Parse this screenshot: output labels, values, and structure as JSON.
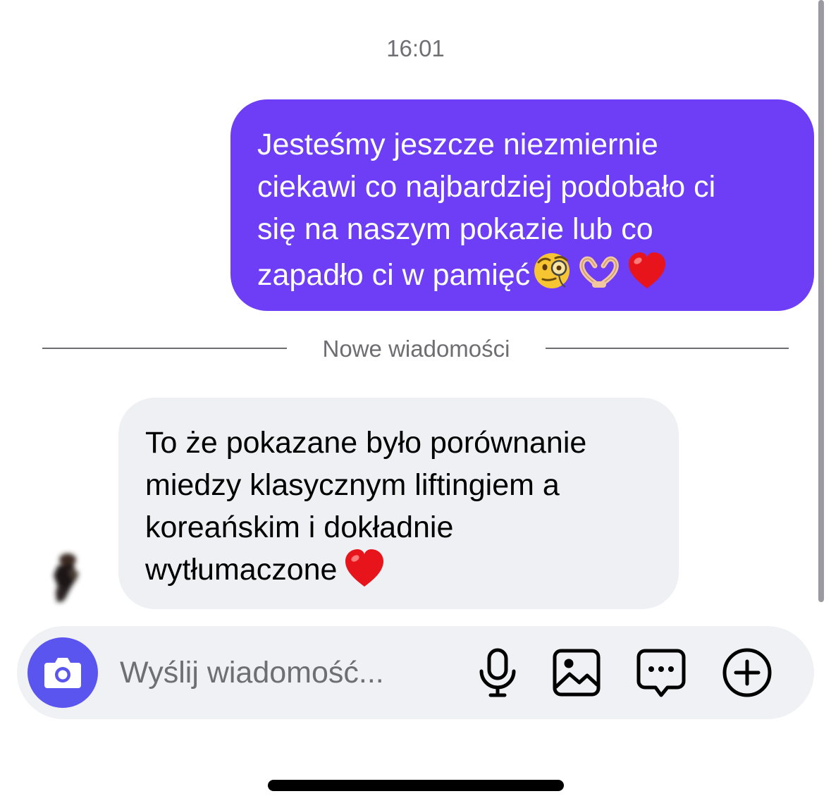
{
  "conversation": {
    "timestamp": "16:01",
    "outgoing_message": {
      "text": "Jesteśmy jeszcze niezmiernie\nciekawi co najbardziej podobało ci\nsię na naszym pokazie lub co\nzapadło ci w pamięć",
      "emojis": [
        "face-with-monocle",
        "heart-hands",
        "red-heart"
      ],
      "bubble_color": "#6d3ef5"
    },
    "divider_label": "Nowe wiadomości",
    "incoming_message": {
      "text": "To że pokazane było porównanie\nmiedzy klasycznym liftingiem a\nkoreańskim i dokładnie\nwytłumaczone",
      "emojis": [
        "red-heart"
      ],
      "bubble_color": "#eef0f3"
    }
  },
  "composer": {
    "placeholder": "Wyślij wiadomość...",
    "camera_button_color": "#5b55f0",
    "icons": [
      "camera-icon",
      "microphone-icon",
      "gallery-icon",
      "sticker-chat-icon",
      "add-circle-icon"
    ]
  }
}
